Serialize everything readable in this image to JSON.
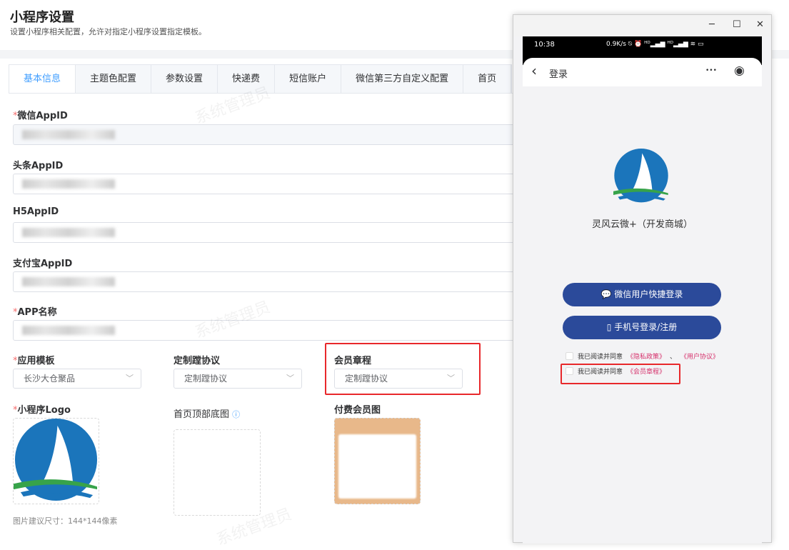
{
  "header": {
    "title": "小程序设置",
    "subtitle": "设置小程序相关配置，允许对指定小程序设置指定模板。"
  },
  "tabs": [
    "基本信息",
    "主题色配置",
    "参数设置",
    "快递费",
    "短信账户",
    "微信第三方自定义配置",
    "首页"
  ],
  "form": {
    "wechat_appid": "微信AppID",
    "toutiao_appid": "头条AppID",
    "h5_appid": "H5AppID",
    "alipay_appid": "支付宝AppID",
    "app_name": "APP名称",
    "app_template": {
      "label": "应用模板",
      "value": "长沙大仓聚品"
    },
    "custom_agreement": {
      "label": "定制蹚协议",
      "value": "定制蹚协议"
    },
    "member_rules": {
      "label": "会员章程",
      "value": "定制蹚协议"
    },
    "logo_label": "小程序Logo",
    "home_bg_label": "首页顶部底图",
    "paid_member_label": "付费会员图",
    "image_hint": "图片建议尺寸：144*144像素"
  },
  "watermark": "系统管理员",
  "window": {
    "minimize": "─",
    "maximize": "☐",
    "close": "✕"
  },
  "phone": {
    "time": "10:38",
    "net": "0.9K/s ⍉ ⏰ ᴴᴰ▂▄▆ ᴴᴰ▂▄▆ ≋ ▭",
    "back": "‹",
    "title": "登录",
    "more": "•••",
    "target": "◉",
    "app_name": "灵风云微+（开发商城）",
    "wechat_login": "微信用户快捷登录",
    "phone_login": "手机号登录/注册",
    "agree1_prefix": "我已阅读并同意",
    "privacy": "《隐私政策》",
    "sep": "、",
    "user_agreement": "《用户协议》",
    "agree2_prefix": "我已阅读并同意",
    "member_rules": "《会员章程》"
  },
  "colors": {
    "accent": "#409eff",
    "brand": "#2b4a9a",
    "highlight": "#e8282b"
  }
}
